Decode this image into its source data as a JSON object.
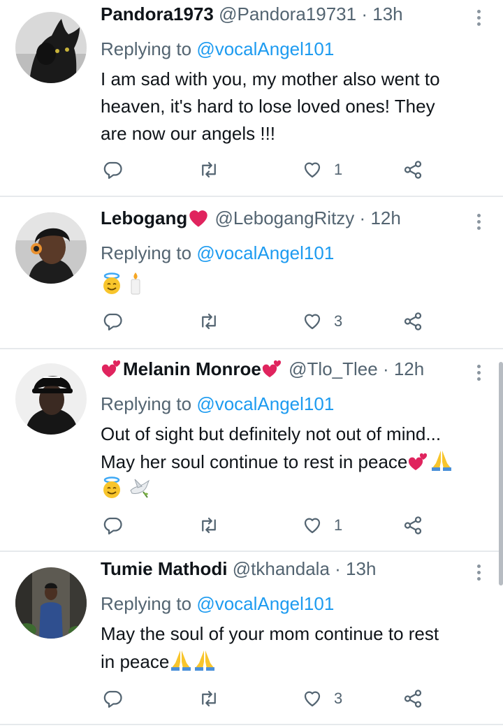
{
  "tweets": [
    {
      "name": "Pandora1973",
      "handle": "@Pandora19731",
      "dot": "·",
      "time": "13h",
      "replying_prefix": "Replying to ",
      "replying_to": "@vocalAngel101",
      "lines": [
        "I am sad with you, my mother also went to",
        "heaven, it's hard to lose loved ones! They",
        "are now our angels !!!"
      ],
      "reply_count": "",
      "retweet_count": "",
      "like_count": "1"
    },
    {
      "name": "Lebogang",
      "handle": "@LebogangRitzy",
      "dot": "·",
      "time": "12h",
      "replying_prefix": "Replying to ",
      "replying_to": "@vocalAngel101",
      "emojis": [
        "halo-smiley-emoji",
        "candle-emoji"
      ],
      "reply_count": "",
      "retweet_count": "",
      "like_count": "3"
    },
    {
      "name": "Melanin Monroe",
      "handle": "@Tlo_Tlee",
      "dot": "·",
      "time": "12h",
      "replying_prefix": "Replying to ",
      "replying_to": "@vocalAngel101",
      "lines": [
        "Out of sight but definitely not out of mind...",
        "May her soul continue to rest in peace"
      ],
      "reply_count": "",
      "retweet_count": "",
      "like_count": "1"
    },
    {
      "name": "Tumie Mathodi",
      "handle": "@tkhandala",
      "dot": "·",
      "time": "13h",
      "replying_prefix": "Replying to ",
      "replying_to": "@vocalAngel101",
      "lines": [
        "May the soul of your mom continue to rest",
        "in peace"
      ],
      "reply_count": "",
      "retweet_count": "",
      "like_count": "3"
    }
  ],
  "icons": {
    "reply": "reply-icon",
    "retweet": "retweet-icon",
    "like": "heart-icon",
    "share": "share-icon",
    "more": "more-options-icon"
  },
  "colors": {
    "mention": "#1d9bf0",
    "secondary_text": "#536471",
    "heart_emoji": "#e0245e",
    "divider": "#e6e9ec"
  }
}
